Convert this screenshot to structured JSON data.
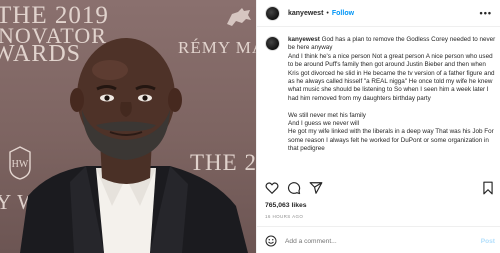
{
  "photo": {
    "backdrop": {
      "line1": "THE 2019",
      "line2": "NOVATOR",
      "line3": "WARDS",
      "brand": "RÉMY MA",
      "line5": "THE 20",
      "line6": "Y WINS"
    },
    "seal_text": "HW"
  },
  "header": {
    "username": "kanyewest",
    "separator": "•",
    "follow_label": "Follow",
    "more_icon": "•••"
  },
  "caption": {
    "username": "kanyewest",
    "lines": [
      "God has a plan to remove the Godless Corey needed to never be here anyway",
      "And I think he's a nice person Not a great person A nice person who used to be around Puff's family then got around Justin Bieber and then when Kris got divorced he slid in He became the tv version of a father figure and as he always called hisself \"a REAL nigga\" He once told my wife he knew what music she should be listening to So when I seen him a week later I had him removed from my daughters birthday party",
      "We still never met his family",
      "And I guess we never will",
      "He got my wife linked with the liberals in a deep way That was his Job For some reason I always felt he worked for DuPont or some organization in that pedigree"
    ]
  },
  "actions": {
    "like_icon": "heart-icon",
    "comment_icon": "comment-icon",
    "share_icon": "share-icon",
    "save_icon": "bookmark-icon"
  },
  "likes": "765,063 likes",
  "timestamp": "16 HOURS AGO",
  "comment_box": {
    "placeholder": "Add a comment...",
    "post_label": "Post"
  },
  "colors": {
    "accent": "#0095f6",
    "post_disabled": "#b2dffc",
    "muted": "#8e8e8e"
  }
}
